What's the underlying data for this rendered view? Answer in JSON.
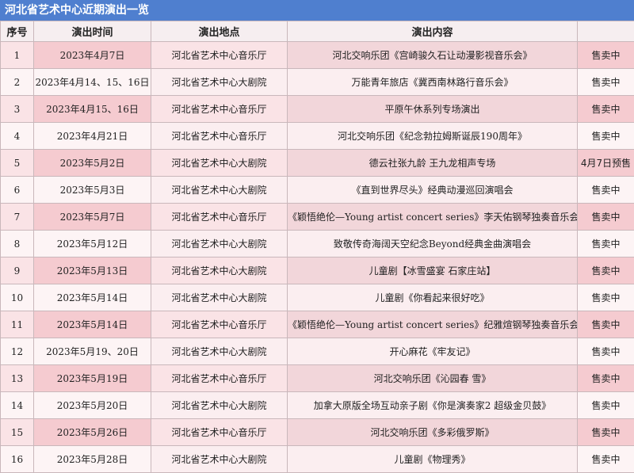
{
  "title": "河北省艺术中心近期演出一览",
  "headers": {
    "no": "序号",
    "date": "演出时间",
    "venue": "演出地点",
    "content": "演出内容",
    "status": ""
  },
  "rows": [
    {
      "no": "1",
      "date": "2023年4月7日",
      "venue": "河北省艺术中心音乐厅",
      "content": "河北交响乐团《宫崎骏久石让动漫影视音乐会》",
      "status": "售卖中"
    },
    {
      "no": "2",
      "date": "2023年4月14、15、16日",
      "venue": "河北省艺术中心大剧院",
      "content": "万能青年旅店《冀西南林路行音乐会》",
      "status": "售卖中"
    },
    {
      "no": "3",
      "date": "2023年4月15、16日",
      "venue": "河北省艺术中心音乐厅",
      "content": "平原午休系列专场演出",
      "status": "售卖中"
    },
    {
      "no": "4",
      "date": "2023年4月21日",
      "venue": "河北省艺术中心音乐厅",
      "content": "河北交响乐团《纪念勃拉姆斯诞辰190周年》",
      "status": "售卖中"
    },
    {
      "no": "5",
      "date": "2023年5月2日",
      "venue": "河北省艺术中心大剧院",
      "content": "德云社张九龄 王九龙相声专场",
      "status": "4月7日预售"
    },
    {
      "no": "6",
      "date": "2023年5月3日",
      "venue": "河北省艺术中心大剧院",
      "content": "《直到世界尽头》经典动漫巡回演唱会",
      "status": "售卖中"
    },
    {
      "no": "7",
      "date": "2023年5月7日",
      "venue": "河北省艺术中心音乐厅",
      "content": "《颖悟绝伦—Young artist concert series》李天佑钢琴独奏音乐会",
      "status": "售卖中"
    },
    {
      "no": "8",
      "date": "2023年5月12日",
      "venue": "河北省艺术中心大剧院",
      "content": "致敬传奇海阔天空纪念Beyond经典金曲演唱会",
      "status": "售卖中"
    },
    {
      "no": "9",
      "date": "2023年5月13日",
      "venue": "河北省艺术中心大剧院",
      "content": "儿童剧【冰雪盛宴 石家庄站】",
      "status": "售卖中"
    },
    {
      "no": "10",
      "date": "2023年5月14日",
      "venue": "河北省艺术中心大剧院",
      "content": "儿童剧《你看起来很好吃》",
      "status": "售卖中"
    },
    {
      "no": "11",
      "date": "2023年5月14日",
      "venue": "河北省艺术中心音乐厅",
      "content": "《颖悟绝伦—Young artist concert series》纪雅煊钢琴独奏音乐会",
      "status": "售卖中"
    },
    {
      "no": "12",
      "date": "2023年5月19、20日",
      "venue": "河北省艺术中心大剧院",
      "content": "开心麻花《牢友记》",
      "status": "售卖中"
    },
    {
      "no": "13",
      "date": "2023年5月19日",
      "venue": "河北省艺术中心音乐厅",
      "content": "河北交响乐团《沁园春 雪》",
      "status": "售卖中"
    },
    {
      "no": "14",
      "date": "2023年5月20日",
      "venue": "河北省艺术中心大剧院",
      "content": "加拿大原版全场互动亲子剧《你是演奏家2 超级金贝鼓》",
      "status": "售卖中"
    },
    {
      "no": "15",
      "date": "2023年5月26日",
      "venue": "河北省艺术中心音乐厅",
      "content": "河北交响乐团《多彩俄罗斯》",
      "status": "售卖中"
    },
    {
      "no": "16",
      "date": "2023年5月28日",
      "venue": "河北省艺术中心大剧院",
      "content": "儿童剧《物理秀》",
      "status": "售卖中"
    }
  ],
  "colors": {
    "title_bar": "#4f7fcf",
    "header_bg": "#f6eef0",
    "odd_row": "#fae3e6",
    "odd_row_accent": "#f5cbd0",
    "even_row": "#fdf4f5",
    "border": "#c9b7bb"
  }
}
